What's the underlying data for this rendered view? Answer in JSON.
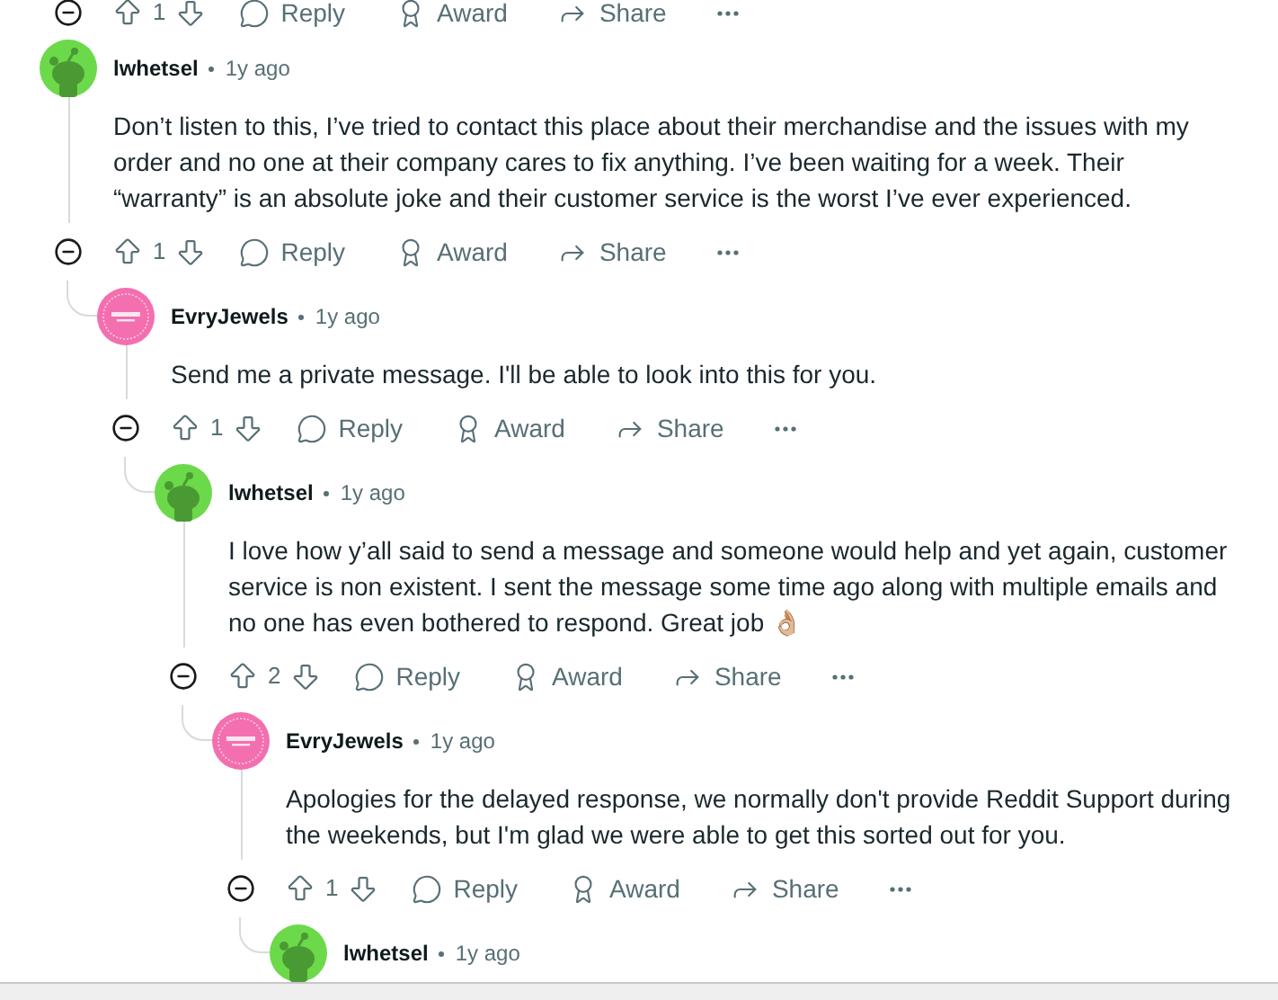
{
  "top_actions": {
    "votes": "1",
    "reply": "Reply",
    "award": "Award",
    "share": "Share"
  },
  "comments": [
    {
      "author": "lwhetsel",
      "kind": "snoo",
      "time": "1y ago",
      "body": "Don’t listen to this, I’ve tried to contact this place about their merchandise and the issues with my order and no one at their company cares to fix anything. I’ve been waiting for a week. Their “warranty” is an absolute joke and their customer service is the worst I’ve ever experienced.",
      "votes": "1",
      "reply": "Reply",
      "award": "Award",
      "share": "Share",
      "children": [
        {
          "author": "EvryJewels",
          "kind": "brand",
          "time": "1y ago",
          "body": "Send me a private message. I'll be able to look into this for you.",
          "votes": "1",
          "reply": "Reply",
          "award": "Award",
          "share": "Share",
          "children": [
            {
              "author": "lwhetsel",
              "kind": "snoo",
              "time": "1y ago",
              "body": "I love how y’all said to send a message and someone would help and yet again, customer service is non existent. I sent the message some time ago along with multiple emails and no one has even bothered to respond. Great job 👌🏼",
              "votes": "2",
              "reply": "Reply",
              "award": "Award",
              "share": "Share",
              "children": [
                {
                  "author": "EvryJewels",
                  "kind": "brand",
                  "time": "1y ago",
                  "body": "Apologies for the delayed response, we normally don't provide Reddit Support during the weekends, but I'm glad we were able to get this sorted out for you.",
                  "votes": "1",
                  "reply": "Reply",
                  "award": "Award",
                  "share": "Share",
                  "children": [
                    {
                      "author": "lwhetsel",
                      "kind": "snoo",
                      "time": "1y ago"
                    }
                  ]
                }
              ]
            }
          ]
        }
      ]
    }
  ]
}
